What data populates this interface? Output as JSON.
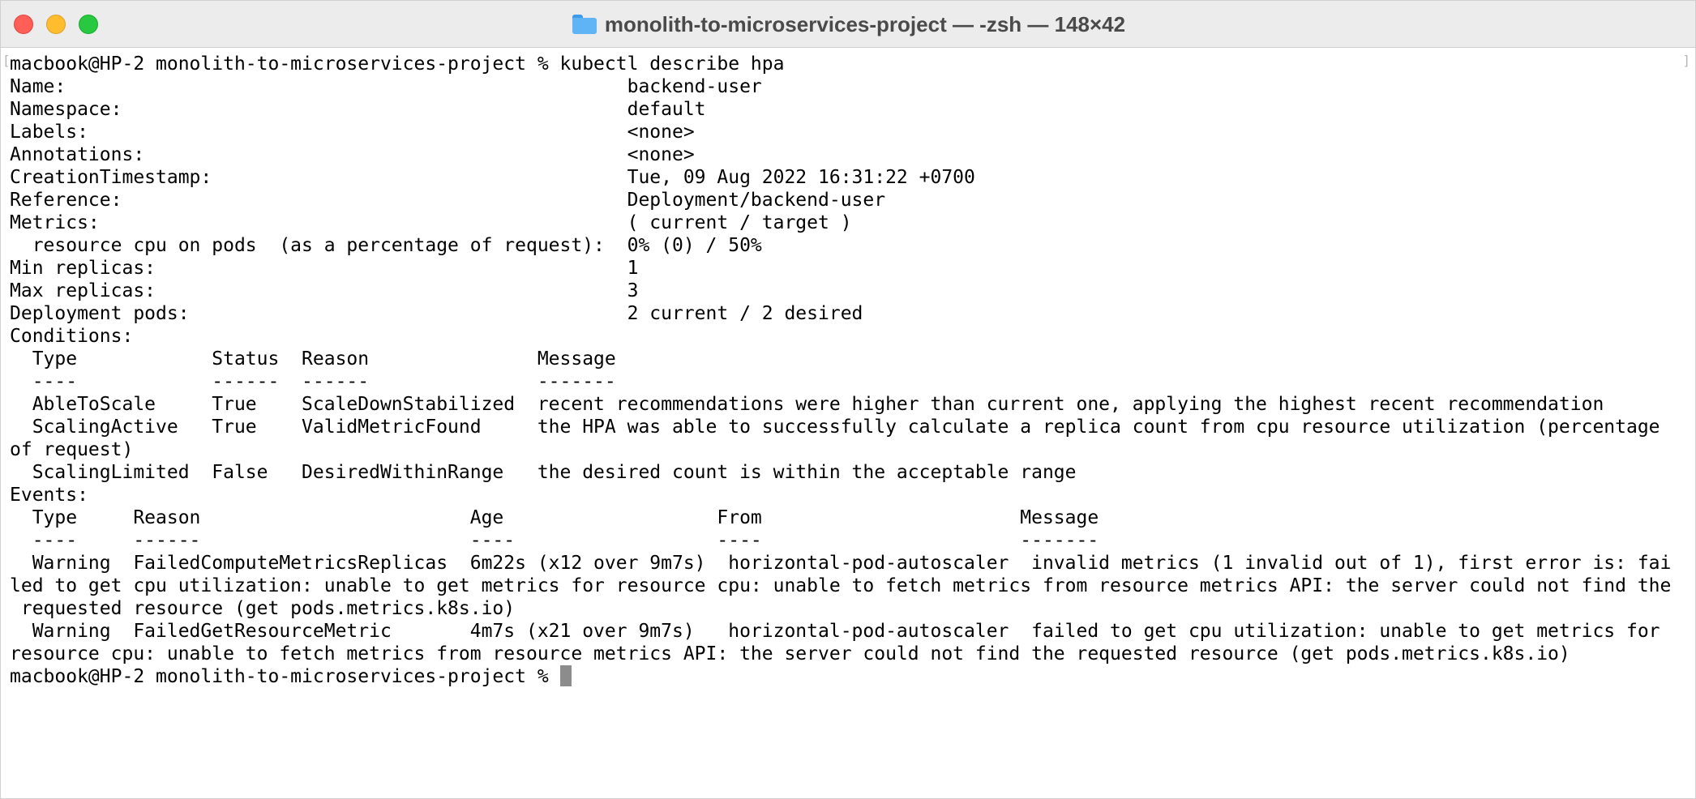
{
  "window": {
    "title": "monolith-to-microservices-project — -zsh — 148×42",
    "folder_icon": "folder-icon"
  },
  "terminal": {
    "lines": [
      "macbook@HP-2 monolith-to-microservices-project % kubectl describe hpa",
      "Name:                                                  backend-user",
      "Namespace:                                             default",
      "Labels:                                                <none>",
      "Annotations:                                           <none>",
      "CreationTimestamp:                                     Tue, 09 Aug 2022 16:31:22 +0700",
      "Reference:                                             Deployment/backend-user",
      "Metrics:                                               ( current / target )",
      "  resource cpu on pods  (as a percentage of request):  0% (0) / 50%",
      "Min replicas:                                          1",
      "Max replicas:                                          3",
      "Deployment pods:                                       2 current / 2 desired",
      "Conditions:",
      "  Type            Status  Reason               Message",
      "  ----            ------  ------               -------",
      "  AbleToScale     True    ScaleDownStabilized  recent recommendations were higher than current one, applying the highest recent recommendation",
      "  ScalingActive   True    ValidMetricFound     the HPA was able to successfully calculate a replica count from cpu resource utilization (percentage",
      "of request)",
      "  ScalingLimited  False   DesiredWithinRange   the desired count is within the acceptable range",
      "Events:",
      "  Type     Reason                        Age                   From                       Message",
      "  ----     ------                        ----                  ----                       -------",
      "  Warning  FailedComputeMetricsReplicas  6m22s (x12 over 9m7s)  horizontal-pod-autoscaler  invalid metrics (1 invalid out of 1), first error is: fai",
      "led to get cpu utilization: unable to get metrics for resource cpu: unable to fetch metrics from resource metrics API: the server could not find the",
      " requested resource (get pods.metrics.k8s.io)",
      "  Warning  FailedGetResourceMetric       4m7s (x21 over 9m7s)   horizontal-pod-autoscaler  failed to get cpu utilization: unable to get metrics for",
      "resource cpu: unable to fetch metrics from resource metrics API: the server could not find the requested resource (get pods.metrics.k8s.io)"
    ],
    "prompt": "macbook@HP-2 monolith-to-microservices-project % "
  }
}
